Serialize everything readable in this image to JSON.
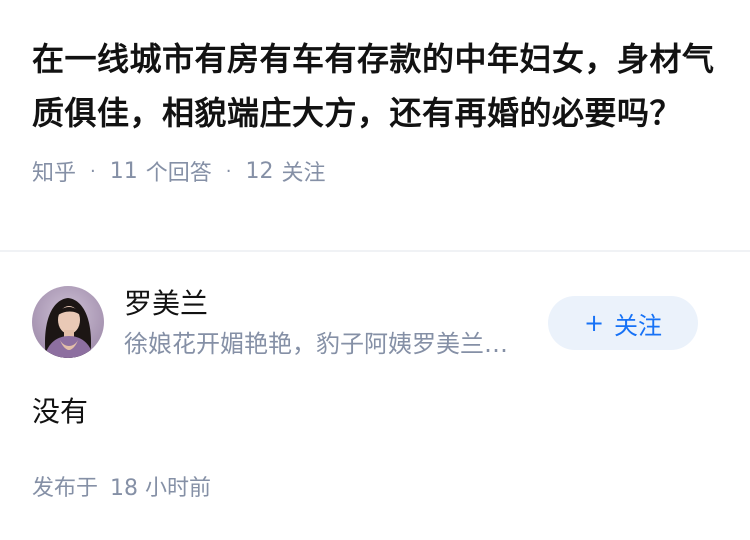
{
  "question": {
    "title": "在一线城市有房有车有存款的中年妇女，身材气质俱佳，相貌端庄大方，还有再婚的必要吗？",
    "source": "知乎",
    "answer_count": "11",
    "answer_label": "个回答",
    "follow_count": "12",
    "follow_label": "关注"
  },
  "author": {
    "name": "罗美兰",
    "bio": "徐娘花开媚艳艳，豹子阿姨罗美兰…",
    "avatar_icon": "user-avatar",
    "follow_button_label": "关注",
    "follow_button_icon": "plus-icon"
  },
  "answer": {
    "content": "没有",
    "published_prefix": "发布于",
    "published_time": "18 小时前"
  },
  "colors": {
    "text_primary": "#121212",
    "text_secondary": "#8590a6",
    "accent": "#1772f6",
    "button_bg": "#ebf2fb",
    "divider": "#f0f2f5"
  }
}
